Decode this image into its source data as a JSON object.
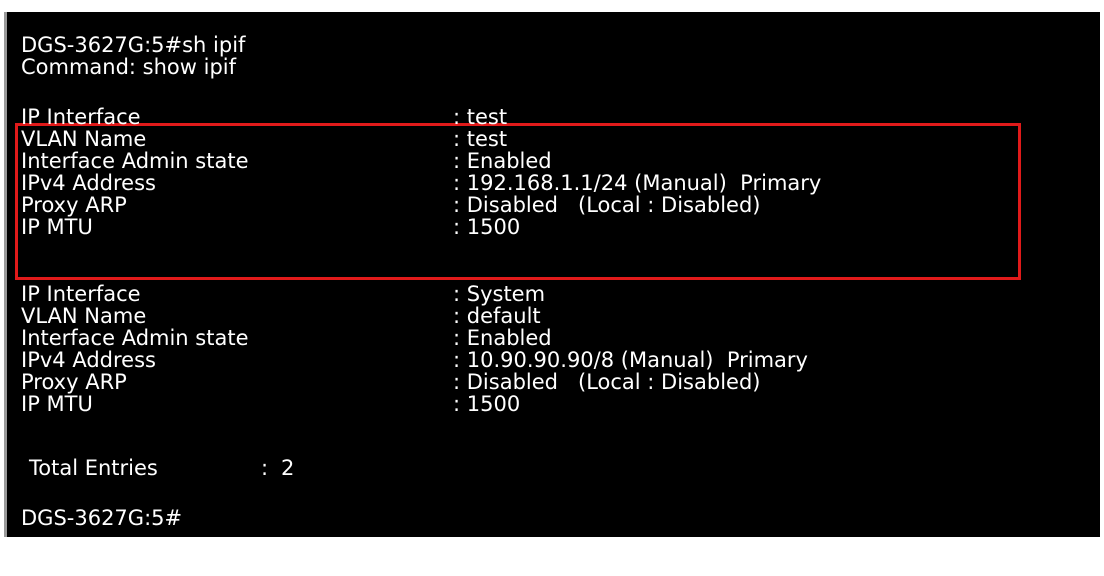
{
  "terminal": {
    "colors": {
      "background": "#000000",
      "text": "#ffffff",
      "highlight_border": "#e01a1a",
      "frame_edge": "#9a9a9a"
    },
    "prompt_command": "DGS-3627G:5#sh ipif",
    "command_echo": "Command: show ipif",
    "interfaces": [
      {
        "highlighted": true,
        "rows": [
          {
            "label": "IP Interface",
            "value": ": test"
          },
          {
            "label": "VLAN Name",
            "value": ": test"
          },
          {
            "label": "Interface Admin state",
            "value": ": Enabled"
          },
          {
            "label": "IPv4 Address",
            "value": ": 192.168.1.1/24 (Manual)  Primary"
          },
          {
            "label": "Proxy ARP",
            "value": ": Disabled   (Local : Disabled)"
          },
          {
            "label": "IP MTU",
            "value": ": 1500"
          }
        ]
      },
      {
        "highlighted": false,
        "rows": [
          {
            "label": "IP Interface",
            "value": ": System"
          },
          {
            "label": "VLAN Name",
            "value": ": default"
          },
          {
            "label": "Interface Admin state",
            "value": ": Enabled"
          },
          {
            "label": "IPv4 Address",
            "value": ": 10.90.90.90/8 (Manual)  Primary"
          },
          {
            "label": "Proxy ARP",
            "value": ": Disabled   (Local : Disabled)"
          },
          {
            "label": "IP MTU",
            "value": ": 1500"
          }
        ]
      }
    ],
    "total_entries_label": "Total Entries",
    "total_entries_sep": ":",
    "total_entries_value": "2",
    "final_prompt": "DGS-3627G:5#"
  }
}
